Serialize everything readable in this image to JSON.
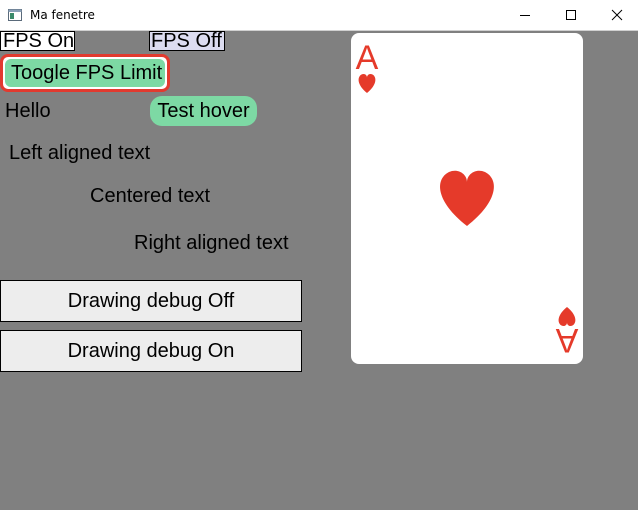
{
  "window": {
    "title": "Ma fenetre"
  },
  "titlebar_controls": {
    "minimize_icon": "minimize-icon",
    "maximize_icon": "maximize-icon",
    "close_icon": "close-icon"
  },
  "fps": {
    "on_label": "FPS On",
    "off_label": "FPS Off"
  },
  "buttons": {
    "toggle_fps_label": "Toogle FPS Limit",
    "test_hover_label": "Test hover",
    "debug_off_label": "Drawing debug Off",
    "debug_on_label": "Drawing debug On"
  },
  "labels": {
    "hello": "Hello",
    "left_aligned": "Left aligned text",
    "centered": "Centered text",
    "right_aligned": "Right aligned text"
  },
  "card": {
    "rank": "A",
    "suit": "heart-icon",
    "color": "#e53a2a"
  },
  "colors": {
    "background": "#808080",
    "accent_green": "#7dd9a4",
    "focus_red": "#e23a2f",
    "button_gray": "#ededed"
  }
}
